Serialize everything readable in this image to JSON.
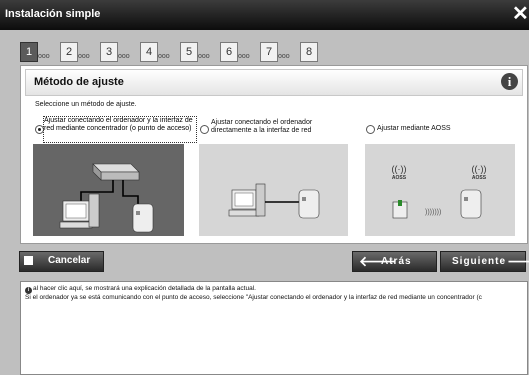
{
  "window": {
    "title": "Instalación simple"
  },
  "steps": [
    "1",
    "2",
    "3",
    "4",
    "5",
    "6",
    "7",
    "8"
  ],
  "active_step": 1,
  "step_dots": "ooo",
  "panel": {
    "title": "Método de ajuste",
    "instruction": "Seleccione un método de ajuste.",
    "options": [
      {
        "label": "Ajustar conectando el ordenador y la interfaz de red mediante concentrador (o punto de acceso)",
        "selected": true
      },
      {
        "label": "Ajustar conectando el ordenador directamente a la interfaz de red",
        "selected": false
      },
      {
        "label": "Ajustar mediante AOSS",
        "selected": false
      }
    ],
    "aoss_label": "AOSS"
  },
  "buttons": {
    "cancel": "Cancelar",
    "back": "Atrás",
    "next": "Siguiente"
  },
  "help": {
    "line1": "al hacer clic aquí, se mostrará una explicación detallada de la pantalla actual.",
    "line2": "Si el ordenador ya se está comunicando con el punto de acceso, seleccione \"Ajustar conectando el ordenador y la interfaz de red mediante un concentrador (c"
  }
}
